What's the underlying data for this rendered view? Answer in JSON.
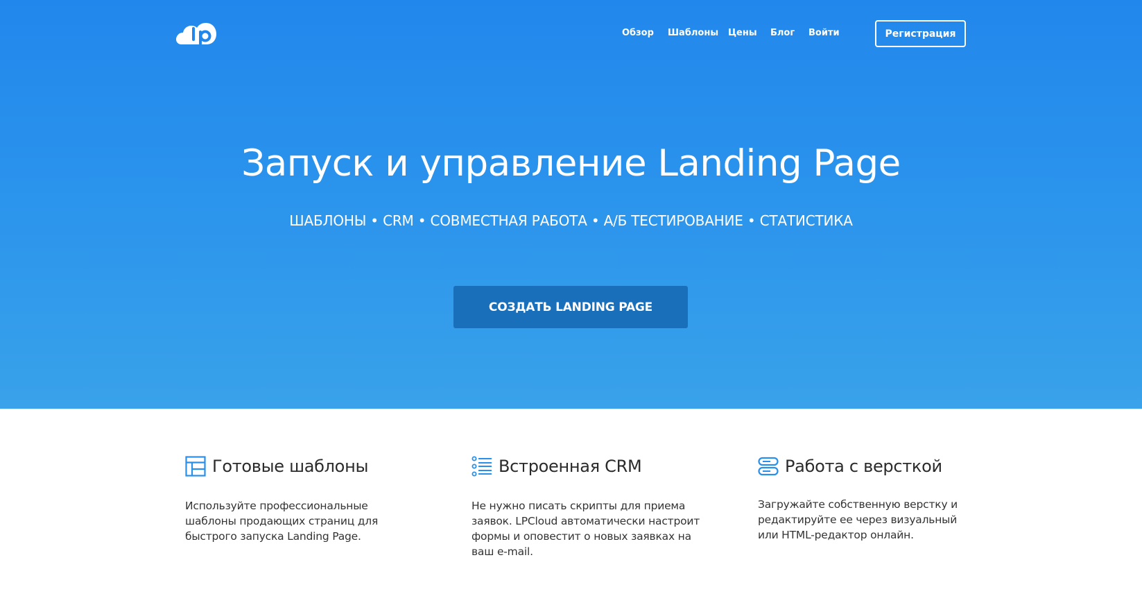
{
  "brand": {
    "logo_text": "lp",
    "colors": {
      "hero_top": "#2287ec",
      "hero_bottom": "#39a2ea",
      "cta": "#1a6fba",
      "icon": "#2a8fe8",
      "text": "#333333"
    }
  },
  "nav": {
    "items": [
      {
        "label": "Обзор"
      },
      {
        "label": "Шаблоны"
      },
      {
        "label": "Цены"
      },
      {
        "label": "Блог"
      },
      {
        "label": "Войти"
      }
    ],
    "register_label": "Регистрация"
  },
  "hero": {
    "title": "Запуск и управление Landing Page",
    "subtitle": "ШАБЛОНЫ • CRM • СОВМЕСТНАЯ РАБОТА • А/Б ТЕСТИРОВАНИЕ • СТАТИСТИКА",
    "cta_label": "СОЗДАТЬ LANDING PAGE"
  },
  "features": [
    {
      "icon": "layout-grid-icon",
      "title": "Готовые шаблоны",
      "text": "Используйте профессиональные шаблоны продающих страниц для быстрого запуска Landing Page."
    },
    {
      "icon": "list-icon",
      "title": "Встроенная CRM",
      "text": "Не нужно писать скрипты для приема заявок. LPCloud автоматически настроит формы и оповестит о новых заявках на ваш e-mail."
    },
    {
      "icon": "server-stack-icon",
      "title": "Работа с версткой",
      "text": "Загружайте собственную верстку и редактируйте ее через визуальный или HTML-редактор онлайн."
    }
  ]
}
